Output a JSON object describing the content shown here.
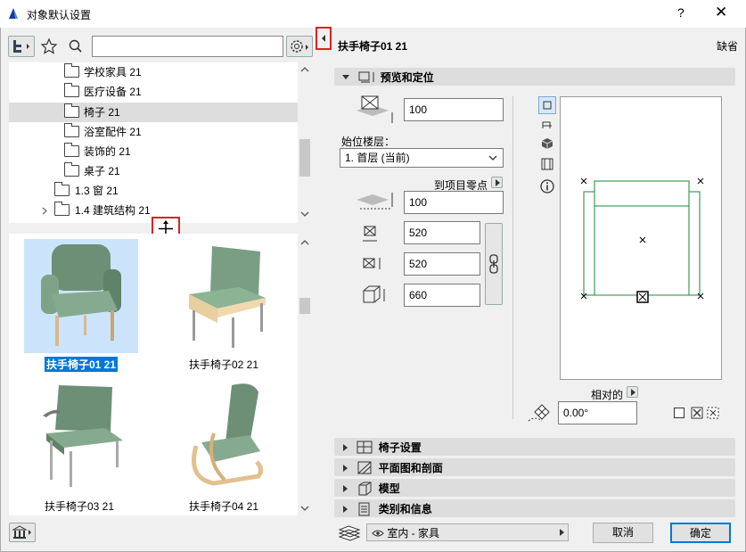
{
  "window": {
    "title": "对象默认设置",
    "help": "?",
    "close": "✕"
  },
  "search": {
    "value": "",
    "placeholder": ""
  },
  "tree": {
    "items": [
      {
        "label": "学校家具 21",
        "indent": 2
      },
      {
        "label": "医疗设备 21",
        "indent": 2
      },
      {
        "label": "椅子 21",
        "indent": 2,
        "selected": true
      },
      {
        "label": "浴室配件 21",
        "indent": 2
      },
      {
        "label": "装饰的 21",
        "indent": 2
      },
      {
        "label": "桌子 21",
        "indent": 2
      },
      {
        "label": "1.3 窗 21",
        "indent": 1
      },
      {
        "label": "1.4 建筑结构 21",
        "indent": 1,
        "expandable": true
      }
    ]
  },
  "gallery": {
    "items": [
      {
        "label": "扶手椅子01 21",
        "selected": true
      },
      {
        "label": "扶手椅子02 21"
      },
      {
        "label": "扶手椅子03 21"
      },
      {
        "label": "扶手椅子04 21"
      }
    ]
  },
  "header": {
    "object_name": "扶手椅子01 21",
    "default_label": "缺省"
  },
  "preview_section": {
    "title": "预览和定位",
    "elevation_value": "100",
    "home_story_label": "始位楼层：",
    "home_story_value": "1. 首层 (当前)",
    "to_project_zero_label": "到项目零点",
    "project_zero_value": "100",
    "width_value": "520",
    "depth_value": "520",
    "height_value": "660",
    "relative_label": "相对的",
    "angle_value": "0.00°"
  },
  "sections": [
    {
      "title": "椅子设置"
    },
    {
      "title": "平面图和剖面"
    },
    {
      "title": "模型"
    },
    {
      "title": "类别和信息"
    }
  ],
  "footer": {
    "layer_value": "室内 - 家具",
    "cancel": "取消",
    "ok": "确定"
  },
  "colors": {
    "selection": "#cce4fb",
    "label_highlight": "#0078d7",
    "accent_red": "#e02020",
    "plan_green": "#1a8a3a"
  }
}
